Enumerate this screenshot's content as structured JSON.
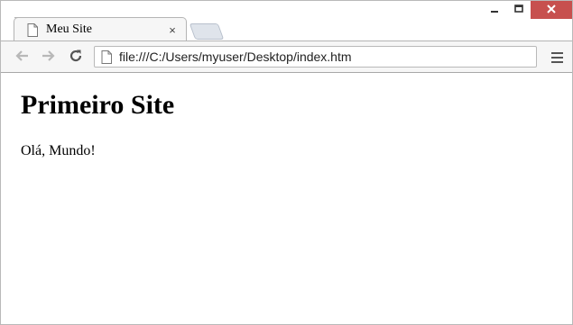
{
  "window": {
    "controls": {
      "minimize_glyph": "‒",
      "maximize_glyph": "▭",
      "close_glyph": "✕",
      "close_color": "#c7504e"
    }
  },
  "tab": {
    "title": "Meu Site",
    "close_glyph": "×",
    "icon": "page-icon"
  },
  "toolbar": {
    "back_icon": "back-arrow-icon",
    "forward_icon": "forward-arrow-icon",
    "reload_icon": "reload-icon",
    "address": "file:///C:/Users/myuser/Desktop/index.htm",
    "menu_icon": "hamburger-menu-icon"
  },
  "page": {
    "heading": "Primeiro Site",
    "paragraph": "Olá, Mundo!"
  }
}
